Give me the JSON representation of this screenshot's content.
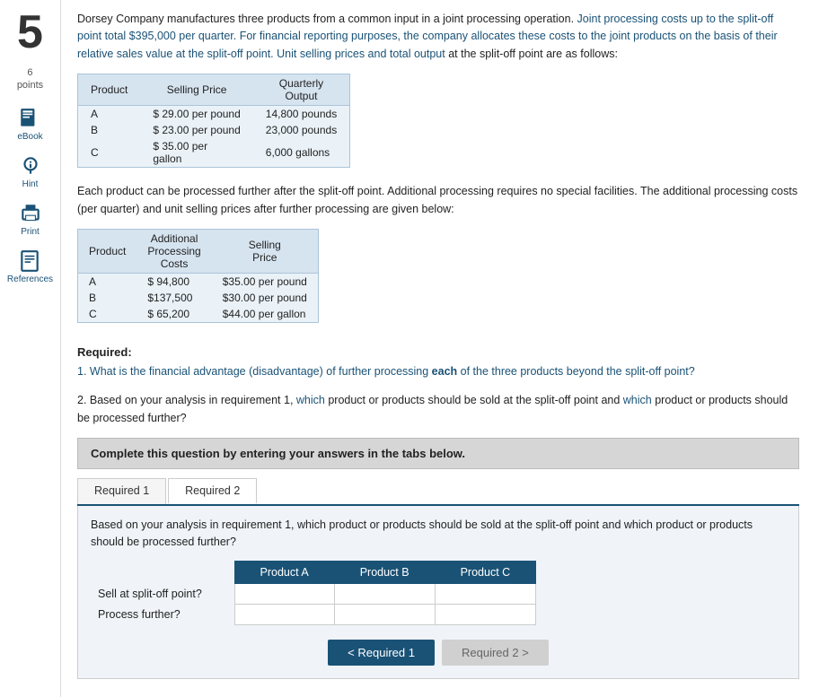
{
  "question_number": "5",
  "points": {
    "value": "6",
    "label": "points"
  },
  "sidebar": {
    "icons": [
      {
        "name": "ebook-icon",
        "label": "eBook",
        "unicode": "📖"
      },
      {
        "name": "hint-icon",
        "label": "Hint",
        "unicode": "💡"
      },
      {
        "name": "print-icon",
        "label": "Print",
        "unicode": "🖨"
      },
      {
        "name": "references-icon",
        "label": "References",
        "unicode": "📋"
      }
    ]
  },
  "problem": {
    "intro": "Dorsey Company manufactures three products from a common input in a joint processing operation. Joint processing costs up to the split-off point total $395,000 per quarter. For financial reporting purposes, the company allocates these costs to the joint products on the basis of their relative sales value at the split-off point. Unit selling prices and total output at the split-off point are as follows:",
    "highlight_phrase": "Joint processing costs up to the split-off point total $395,000 per quarter. For financial reporting purposes, the company allocates these costs to the joint products on the basis of their relative sales value at the split-off point. Unit selling prices and total output",
    "table1": {
      "headers": [
        "Product",
        "Selling Price",
        "Quarterly Output"
      ],
      "rows": [
        {
          "product": "A",
          "price": "$ 29.00 per pound",
          "output": "14,800 pounds"
        },
        {
          "product": "B",
          "price": "$ 23.00 per pound",
          "output": "23,000 pounds"
        },
        {
          "product": "C",
          "price": "$ 35.00 per gallon",
          "output": "6,000 gallons"
        }
      ],
      "c_price_line1": "$ 35.00 per",
      "c_price_line2": "gallon"
    },
    "further_processing_intro": "Each product can be processed further after the split-off point. Additional processing requires no special facilities. The additional processing costs (per quarter) and unit selling prices after further processing are given below:",
    "table2": {
      "headers": [
        "Product",
        "Additional Processing Costs",
        "Selling Price"
      ],
      "rows": [
        {
          "product": "A",
          "cost": "$ 94,800",
          "price": "$35.00 per pound"
        },
        {
          "product": "B",
          "cost": "$137,500",
          "price": "$30.00 per pound"
        },
        {
          "product": "C",
          "cost": "$ 65,200",
          "price": "$44.00 per gallon"
        }
      ]
    }
  },
  "required": {
    "title": "Required:",
    "items": [
      "1. What is the financial advantage (disadvantage) of further processing each of the three products beyond the split-off point?",
      "2. Based on your analysis in requirement 1, which product or products should be sold at the split-off point and which product or products should be processed further?"
    ],
    "instructions_box": "Complete this question by entering your answers in the tabs below.",
    "tabs": [
      {
        "label": "Required 1",
        "active": false
      },
      {
        "label": "Required 2",
        "active": true
      }
    ],
    "tab2_content": {
      "description": "Based on your analysis in requirement 1, which product or products should be sold at the split-off point and which product or products should be processed further?",
      "table_headers": [
        "",
        "Product A",
        "Product B",
        "Product C"
      ],
      "rows": [
        {
          "label": "Sell at split-off point?",
          "a": "",
          "b": "",
          "c": ""
        },
        {
          "label": "Process further?",
          "a": "",
          "b": "",
          "c": ""
        }
      ]
    },
    "nav_buttons": {
      "prev": "Required 1",
      "next": "Required 2"
    }
  }
}
